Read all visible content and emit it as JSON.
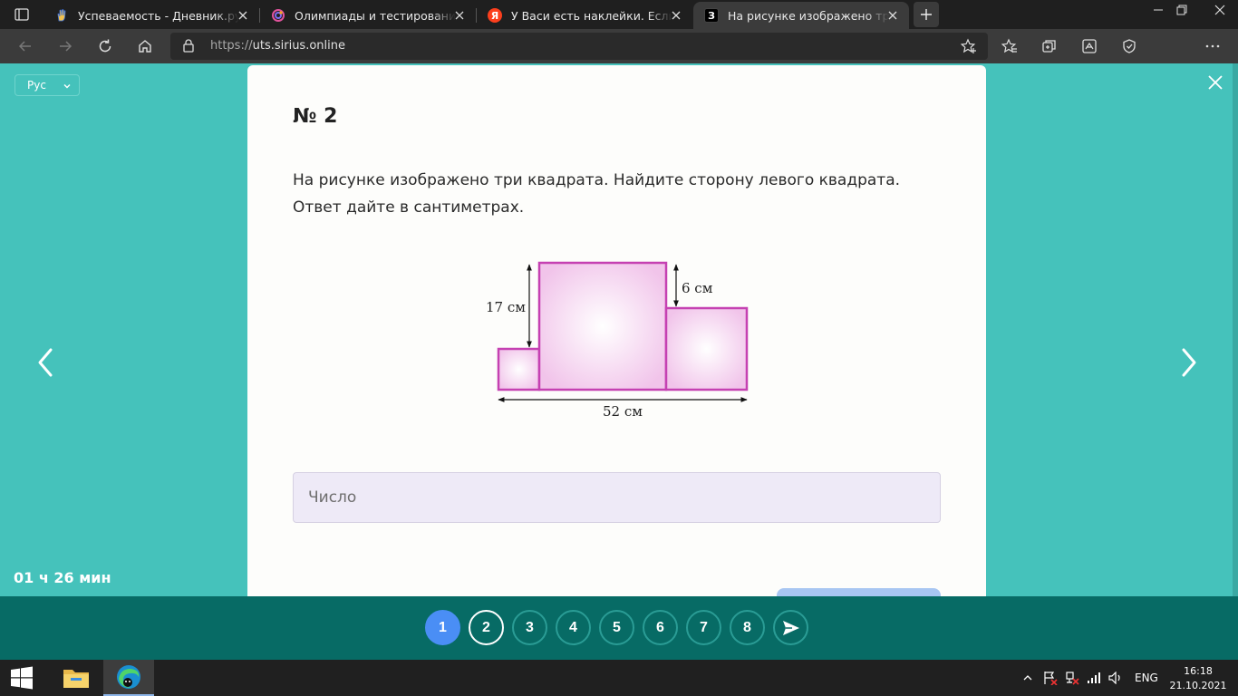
{
  "browser": {
    "tabs": [
      {
        "title": "Успеваемость - Дневник.ру",
        "icon": "dnevnik-hand-icon",
        "active": false
      },
      {
        "title": "Олимпиады и тестирования — С",
        "icon": "sirius-logo-icon",
        "active": false
      },
      {
        "title": "У Васи есть наклейки. Если он р",
        "icon": "yandex-icon",
        "favicon_text": "Я",
        "active": false
      },
      {
        "title": "На рисунке изображено три квадр",
        "icon": "znanija-icon",
        "favicon_text": "З",
        "active": true
      }
    ],
    "url_prefix": "https://",
    "url_domain": "uts.sirius.online"
  },
  "page": {
    "language": "Рус",
    "timer": "01 ч 26 мин",
    "question": {
      "number": "№ 2",
      "text": "На рисунке изображено три квадрата. Найдите сторону левого квадрата. Ответ дайте в сантиметрах.",
      "figure": {
        "label_height": "17 см",
        "label_diff": "6 см",
        "label_width": "52 см"
      },
      "answer_placeholder": "Число"
    }
  },
  "navigation": {
    "questions": [
      "1",
      "2",
      "3",
      "4",
      "5",
      "6",
      "7",
      "8"
    ],
    "current": "1",
    "selected": "2"
  },
  "taskbar": {
    "language": "ENG",
    "time": "16:18",
    "date": "21.10.2021"
  },
  "colors": {
    "page_bg": "#45c2bb",
    "nav_bg": "#076b65",
    "accent_blue": "#4a8ef5",
    "square_stroke": "#c541b2"
  }
}
